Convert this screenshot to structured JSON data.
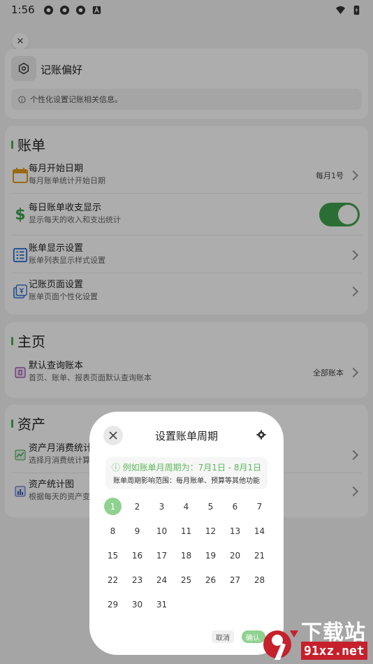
{
  "status": {
    "time": "1:56"
  },
  "preferences": {
    "title": "记账偏好",
    "info": "个性化设置记账相关信息。"
  },
  "bill_section": {
    "title": "账单",
    "items": [
      {
        "title": "每月开始日期",
        "sub": "每月账单统计开始日期",
        "value": "每月1号"
      },
      {
        "title": "每日账单收支显示",
        "sub": "显示每天的收入和支出统计",
        "toggle": true
      },
      {
        "title": "账单显示设置",
        "sub": "账单列表显示样式设置"
      },
      {
        "title": "记账页面设置",
        "sub": "账单页面个性化设置"
      }
    ]
  },
  "home_section": {
    "title": "主页",
    "items": [
      {
        "title": "默认查询账本",
        "sub": "首页、账单、报表页面默认查询账本",
        "value": "全部账本"
      }
    ]
  },
  "asset_section": {
    "title": "资产",
    "items": [
      {
        "title": "资产月消费统计",
        "sub": "选择月消费统计算"
      },
      {
        "title": "资产统计图",
        "sub": "根据每天的资产变"
      }
    ]
  },
  "dialog": {
    "title": "设置账单周期",
    "hint_example": "例如账单月周期为：7月1日 - 8月1日",
    "hint_scope": "账单周期影响范围：每月账单、预算等其他功能",
    "days": [
      "1",
      "2",
      "3",
      "4",
      "5",
      "6",
      "7",
      "8",
      "9",
      "10",
      "11",
      "12",
      "13",
      "14",
      "15",
      "16",
      "17",
      "18",
      "19",
      "20",
      "21",
      "22",
      "23",
      "24",
      "25",
      "26",
      "27",
      "28",
      "29",
      "30",
      "31"
    ],
    "selected_day": "1",
    "cancel_label": "取消",
    "confirm_label": "确认"
  },
  "watermark": {
    "text": "下载站",
    "site": "91xz.net"
  },
  "colors": {
    "accent": "#3fa34d",
    "selected_day": "#8fd18f",
    "hint_green": "#5cb85c"
  }
}
